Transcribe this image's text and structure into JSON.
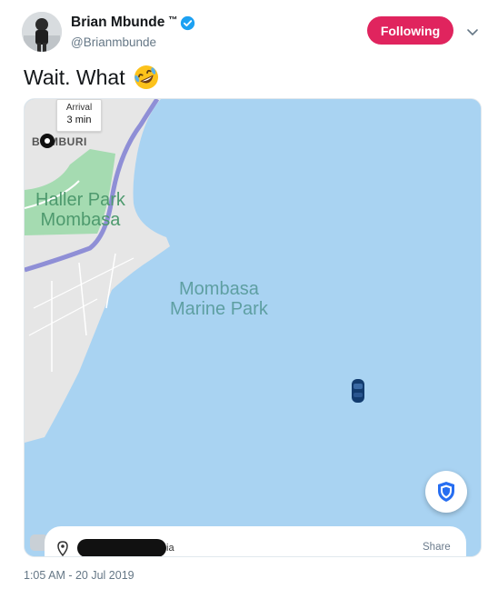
{
  "author": {
    "display_name": "Brian Mbunde",
    "tm_mark": "™",
    "handle": "@Brianmbunde",
    "avatar_icon": "profile-photo",
    "verified_icon": "verified-badge-icon",
    "verified_color": "#1da1f2"
  },
  "follow": {
    "label": "Following",
    "color": "#e0245e",
    "menu_icon": "chevron-down-icon"
  },
  "tweet": {
    "text": "Wait. What",
    "emoji_icon": "rolling-on-floor-laughing-emoji"
  },
  "map": {
    "arrival_label": "Arrival",
    "arrival_time": "3 min",
    "area_label": "BOMBURI",
    "park_label": "Haller Park\nMombasa",
    "marine_label": "Mombasa\nMarine Park",
    "water_color": "#a9d3f2",
    "land_color": "#e6e6e6",
    "park_color": "#a5dbb1",
    "road_color": "#8f8fd6",
    "car_icon": "car-icon",
    "shield_icon": "shield-icon",
    "location_icon": "location-pin-icon",
    "chat_icon": "chat-icon",
    "destination_suffix": "ia",
    "share_label": "Share"
  },
  "timestamp": "1:05 AM - 20 Jul 2019"
}
